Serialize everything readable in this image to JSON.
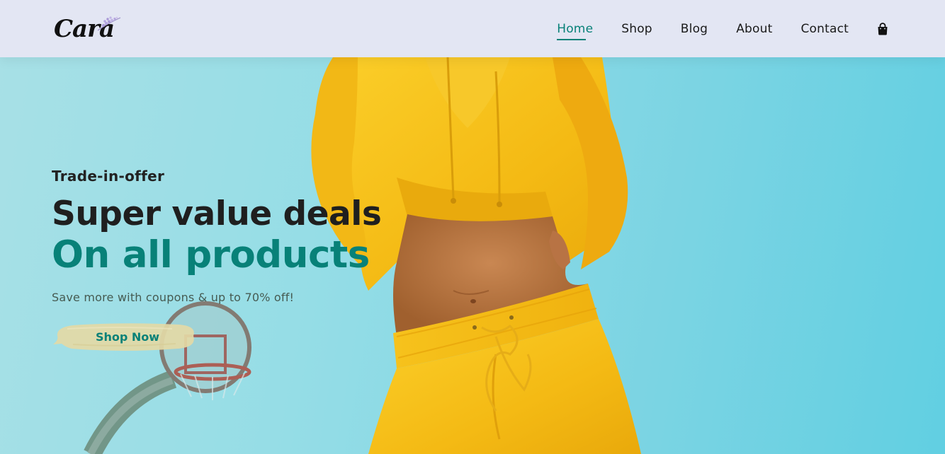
{
  "brand": {
    "logo_text": "Cara",
    "sprig_icon": "lavender-sprig-icon"
  },
  "nav": {
    "items": [
      {
        "label": "Home",
        "active": true
      },
      {
        "label": "Shop",
        "active": false
      },
      {
        "label": "Blog",
        "active": false
      },
      {
        "label": "About",
        "active": false
      },
      {
        "label": "Contact",
        "active": false
      }
    ],
    "cart_icon": "shopping-bag-icon"
  },
  "hero": {
    "subtitle": "Trade-in-offer",
    "heading": "Super value deals",
    "highlight": "On all products",
    "description": "Save more with coupons & up to 70% off!",
    "button_label": "Shop Now"
  },
  "colors": {
    "accent": "#088178",
    "header_bg": "#e3e6f3",
    "button_brush": "#e0d8a8",
    "outfit_yellow": "#f5bf1c"
  }
}
